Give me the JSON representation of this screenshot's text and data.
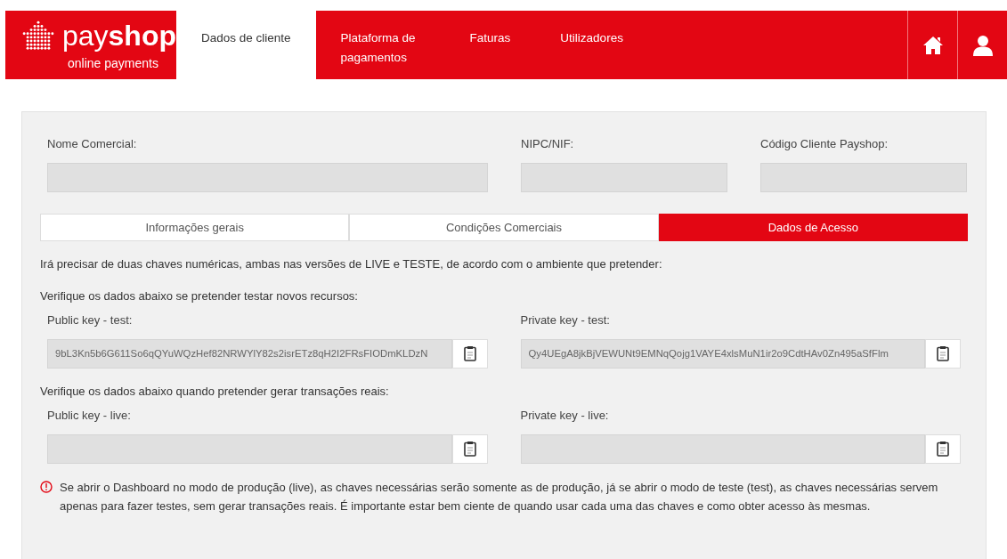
{
  "logo": {
    "wordmark": "pay**shop**",
    "tagline": "online payments"
  },
  "nav": [
    {
      "label": "Dados de cliente",
      "selected": true
    },
    {
      "label": "Plataforma de pagamentos",
      "selected": false
    },
    {
      "label": "Faturas",
      "selected": false
    },
    {
      "label": "Utilizadores",
      "selected": false
    }
  ],
  "client_fields": [
    {
      "label": "Nome Comercial:"
    },
    {
      "label": "NIPC/NIF:"
    },
    {
      "label": "Código Cliente Payshop:"
    }
  ],
  "tabs": [
    {
      "label": "Informações gerais",
      "selected": false
    },
    {
      "label": "Condições Comerciais",
      "selected": false
    },
    {
      "label": "Dados de Acesso",
      "selected": true
    }
  ],
  "intro": "Irá precisar de duas chaves numéricas, ambas nas versões de LIVE e TESTE, de acordo com o ambiente que pretender:",
  "sections": [
    {
      "heading": "Verifique os dados abaixo se pretender testar novos recursos:",
      "keys": [
        {
          "label": "Public key - test:",
          "value": "9bL3Kn5b6G611So6qQYuWQzHef82NRWYlY82s2isrETz8qH2I2FRsFIODmKLDzN"
        },
        {
          "label": "Private key - test:",
          "value": "Qy4UEgA8jkBjVEWUNt9EMNqQojg1VAYE4xlsMuN1ir2o9CdtHAv0Zn495aSfFlm"
        }
      ]
    },
    {
      "heading": "Verifique os dados abaixo quando pretender gerar transações reais:",
      "keys": [
        {
          "label": "Public key - live:"
        },
        {
          "label": "Private key - live:"
        }
      ]
    }
  ],
  "notice": "Se abrir o Dashboard no modo de produção (live), as chaves necessárias serão somente as de produção, já se abrir o modo de teste (test), as chaves necessárias servem apenas para fazer testes, sem gerar transações reais. É importante estar bem ciente de quando usar cada uma das chaves e como obter acesso às mesmas."
}
